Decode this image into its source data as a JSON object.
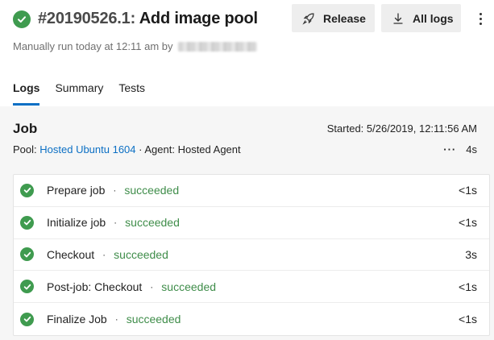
{
  "header": {
    "run_id": "#20190526.1:",
    "run_name": "Add image pool",
    "subtitle": "Manually run today at 12:11 am by",
    "buttons": {
      "release_label": "Release",
      "all_logs_label": "All logs"
    }
  },
  "tabs": [
    {
      "label": "Logs",
      "active": true
    },
    {
      "label": "Summary",
      "active": false
    },
    {
      "label": "Tests",
      "active": false
    }
  ],
  "job": {
    "title": "Job",
    "started": "Started: 5/26/2019, 12:11:56 AM",
    "pool_label": "Pool:",
    "pool_name": "Hosted Ubuntu 1604",
    "agent": "· Agent: Hosted Agent",
    "duration": "4s",
    "more": "···"
  },
  "steps": [
    {
      "name": "Prepare job",
      "status": "succeeded",
      "duration": "<1s"
    },
    {
      "name": "Initialize job",
      "status": "succeeded",
      "duration": "<1s"
    },
    {
      "name": "Checkout",
      "status": "succeeded",
      "duration": "3s"
    },
    {
      "name": "Post-job: Checkout",
      "status": "succeeded",
      "duration": "<1s"
    },
    {
      "name": "Finalize Job",
      "status": "succeeded",
      "duration": "<1s"
    }
  ],
  "colors": {
    "success": "#3f9b4f",
    "link": "#0b6fc4",
    "accent_tab": "#0b6fc4"
  }
}
